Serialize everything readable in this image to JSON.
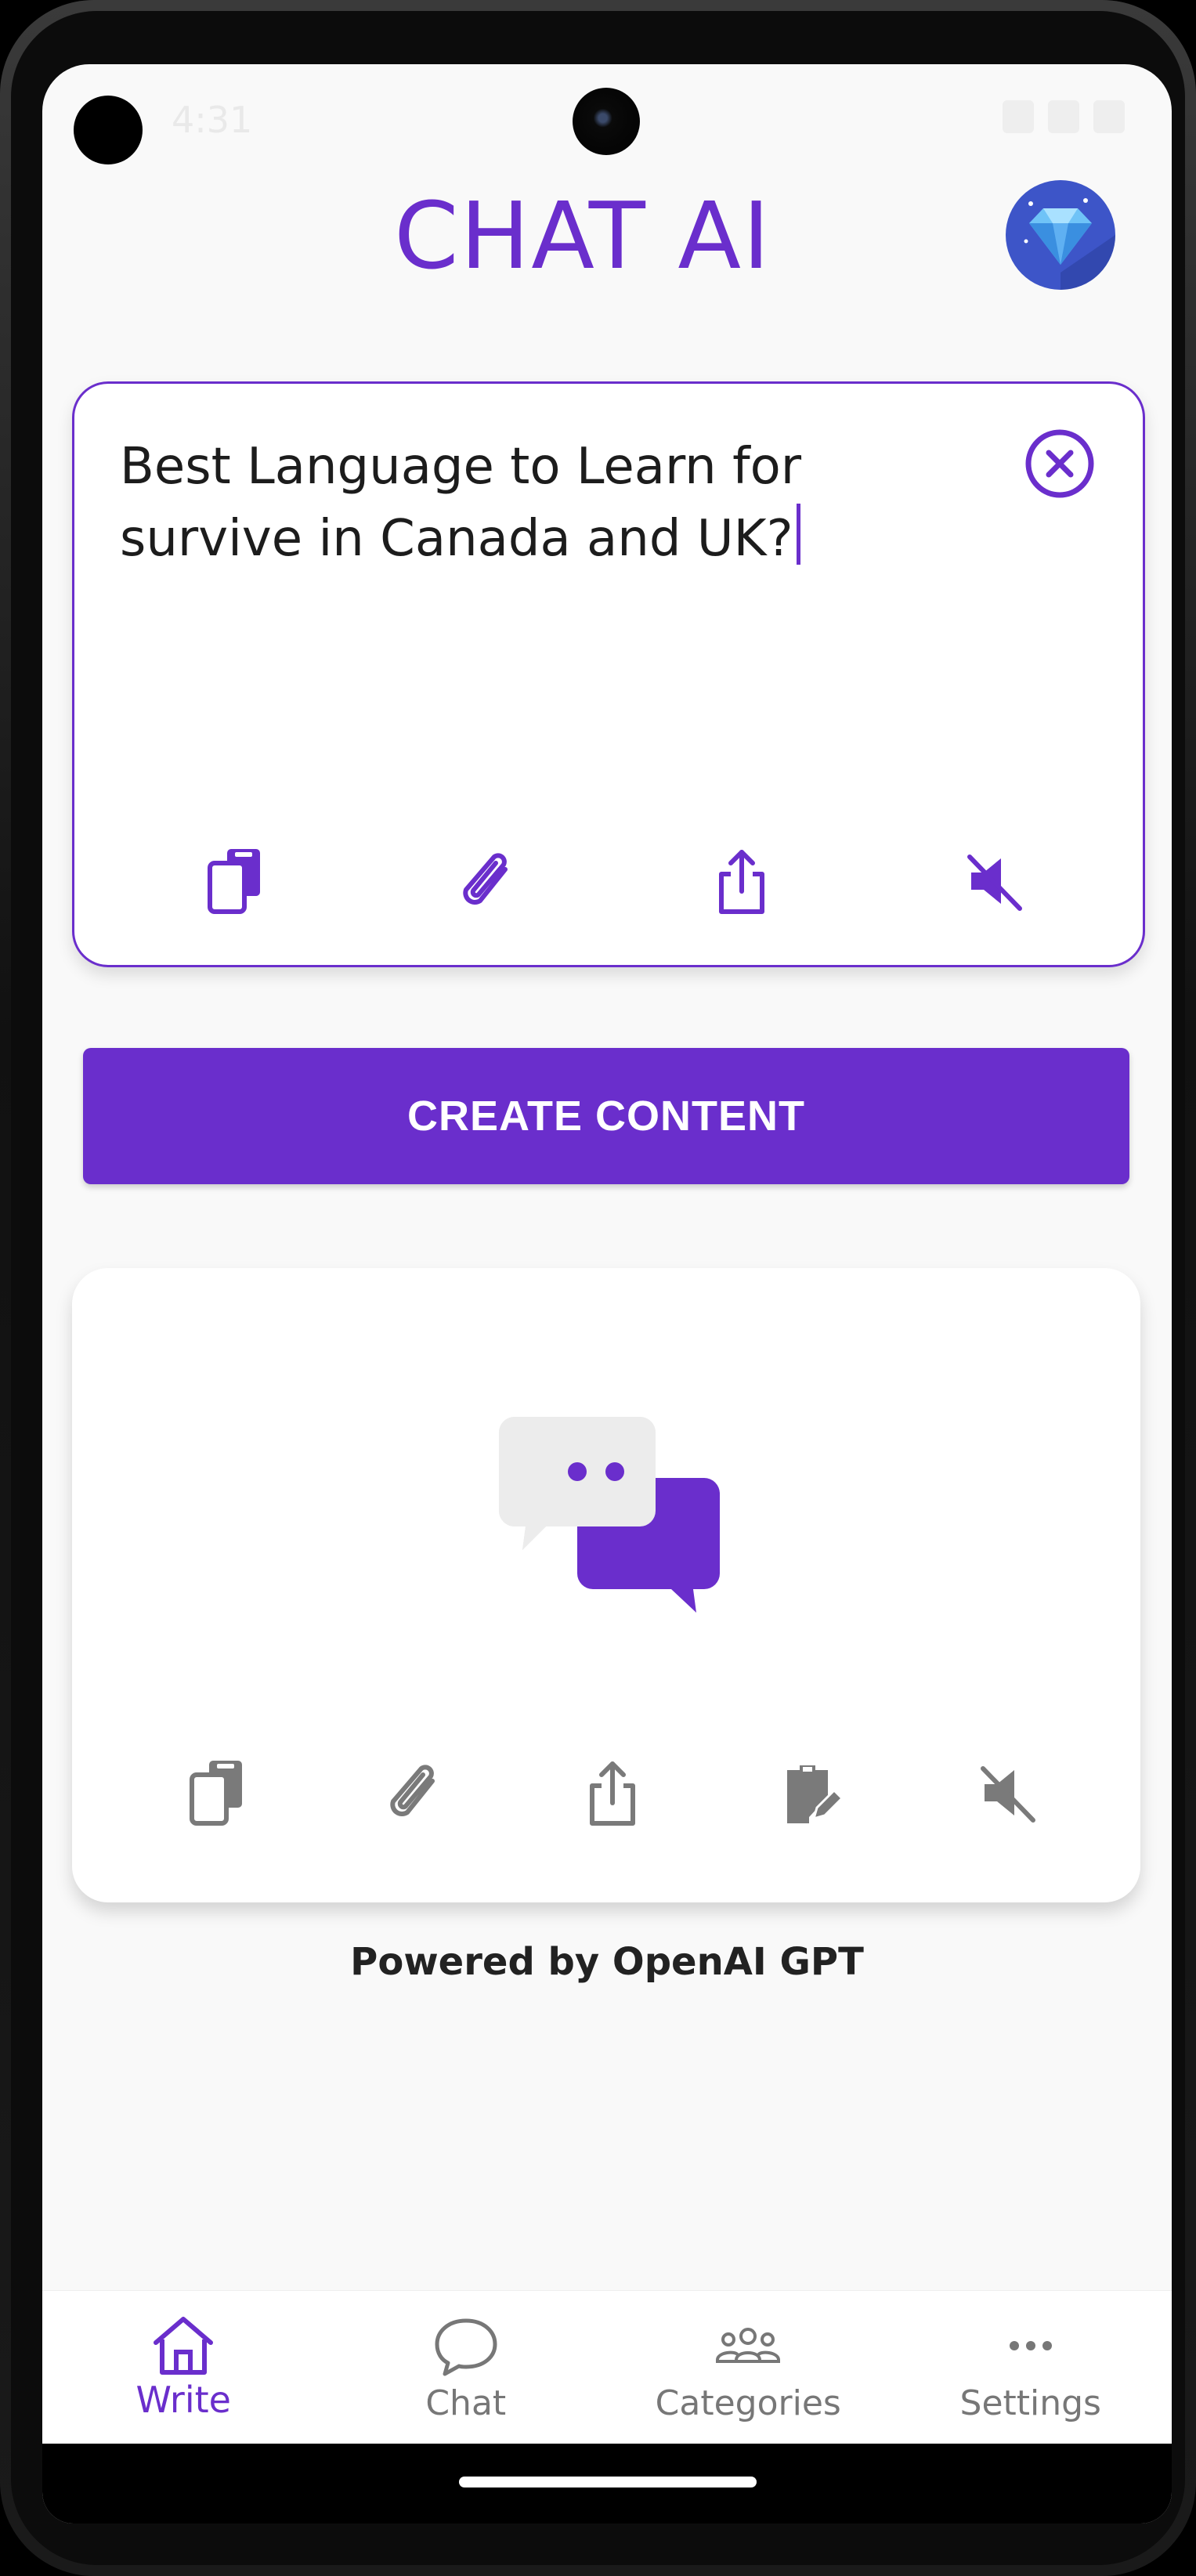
{
  "status_bar": {
    "time": "4:31"
  },
  "header": {
    "title": "CHAT AI",
    "premium_icon": "diamond-icon"
  },
  "input": {
    "text": "Best Language to Learn for survive in Canada and UK?"
  },
  "input_tools": [
    "copy-icon",
    "attach-icon",
    "share-icon",
    "mute-icon"
  ],
  "create_button": {
    "label": "CREATE CONTENT"
  },
  "output_tools": [
    "copy-icon",
    "attach-icon",
    "share-icon",
    "edit-icon",
    "mute-icon"
  ],
  "footer": {
    "powered_by": "Powered by OpenAI GPT"
  },
  "bottom_nav": [
    {
      "label": "Write",
      "icon": "home-icon",
      "active": true
    },
    {
      "label": "Chat",
      "icon": "chat-bubble-icon",
      "active": false
    },
    {
      "label": "Categories",
      "icon": "people-icon",
      "active": false
    },
    {
      "label": "Settings",
      "icon": "more-icon",
      "active": false
    }
  ],
  "colors": {
    "accent": "#6a2ecc",
    "background": "#f9f9f9",
    "muted_icon": "#7a7a7a"
  }
}
